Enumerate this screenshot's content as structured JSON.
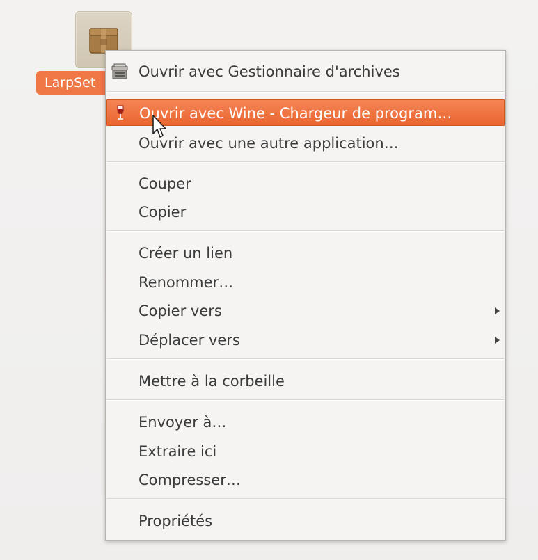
{
  "desktop": {
    "file_icon": {
      "label": "LarpSet",
      "icon": "package-icon"
    }
  },
  "context_menu": {
    "items": [
      {
        "label": "Ouvrir avec Gestionnaire d'archives",
        "icon": "archive-manager-icon"
      },
      {
        "label": "Ouvrir avec Wine - Chargeur de program…",
        "icon": "wine-icon",
        "highlighted": true
      },
      {
        "label": "Ouvrir avec une autre application…"
      },
      {
        "label": "Couper"
      },
      {
        "label": "Copier"
      },
      {
        "label": "Créer un lien"
      },
      {
        "label": "Renommer…"
      },
      {
        "label": "Copier vers",
        "submenu": true
      },
      {
        "label": "Déplacer vers",
        "submenu": true
      },
      {
        "label": "Mettre à la corbeille"
      },
      {
        "label": "Envoyer à…"
      },
      {
        "label": "Extraire ici"
      },
      {
        "label": "Compresser…"
      },
      {
        "label": "Propriétés"
      }
    ]
  },
  "colors": {
    "highlight": "#f07746",
    "menu_background": "#f5f4f3",
    "text": "#3c3c3c",
    "desktop_background": "#f2f1f0"
  },
  "cursor": {
    "icon": "mouse-pointer-icon"
  }
}
